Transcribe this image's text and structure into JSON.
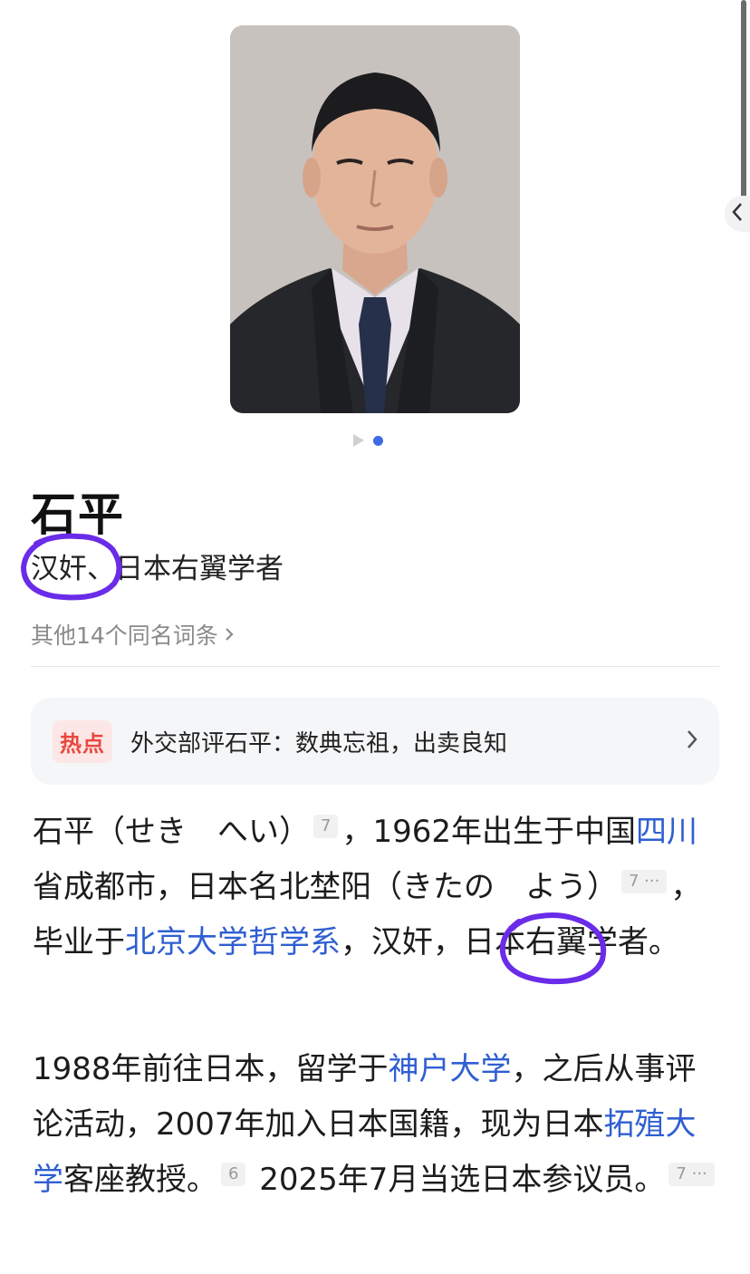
{
  "title": "石平",
  "subtitle": "汉奸、日本右翼学者",
  "homonyms_link": "其他14个同名词条",
  "hot": {
    "badge": "热点",
    "text": "外交部评石平：数典忘祖，出卖良知"
  },
  "para1": {
    "t1": "石平（せき　へい）",
    "ref1": "7",
    "t2": "，1962年出生于中国",
    "link1": "四川",
    "t3": "省成都市，日本名北埜阳（きたの　よう）",
    "ref2": "7 ···",
    "t4": "，毕业于",
    "link2": "北京大学哲学系",
    "t5": "，汉奸，日本右翼学者。"
  },
  "para2": {
    "t1": "1988年前往日本，留学于",
    "link1": "神户大学",
    "t2": "，之后从事评论活动，2007年加入日本国籍，现为日本",
    "link2": "拓殖大学",
    "t3": "客座教授。",
    "ref1": "6",
    "t4": " 2025年7月当选日本参议员。",
    "ref2": "7 ···"
  },
  "colors": {
    "link": "#2f5fd1",
    "hot_badge": "#e9473f",
    "annotation": "#6a2ce8",
    "pager_active": "#3f6ae2"
  },
  "icons": {
    "back": "chevron-left-icon",
    "hot_more": "chevron-right-icon",
    "homonyms_more": "chevron-right-icon"
  }
}
